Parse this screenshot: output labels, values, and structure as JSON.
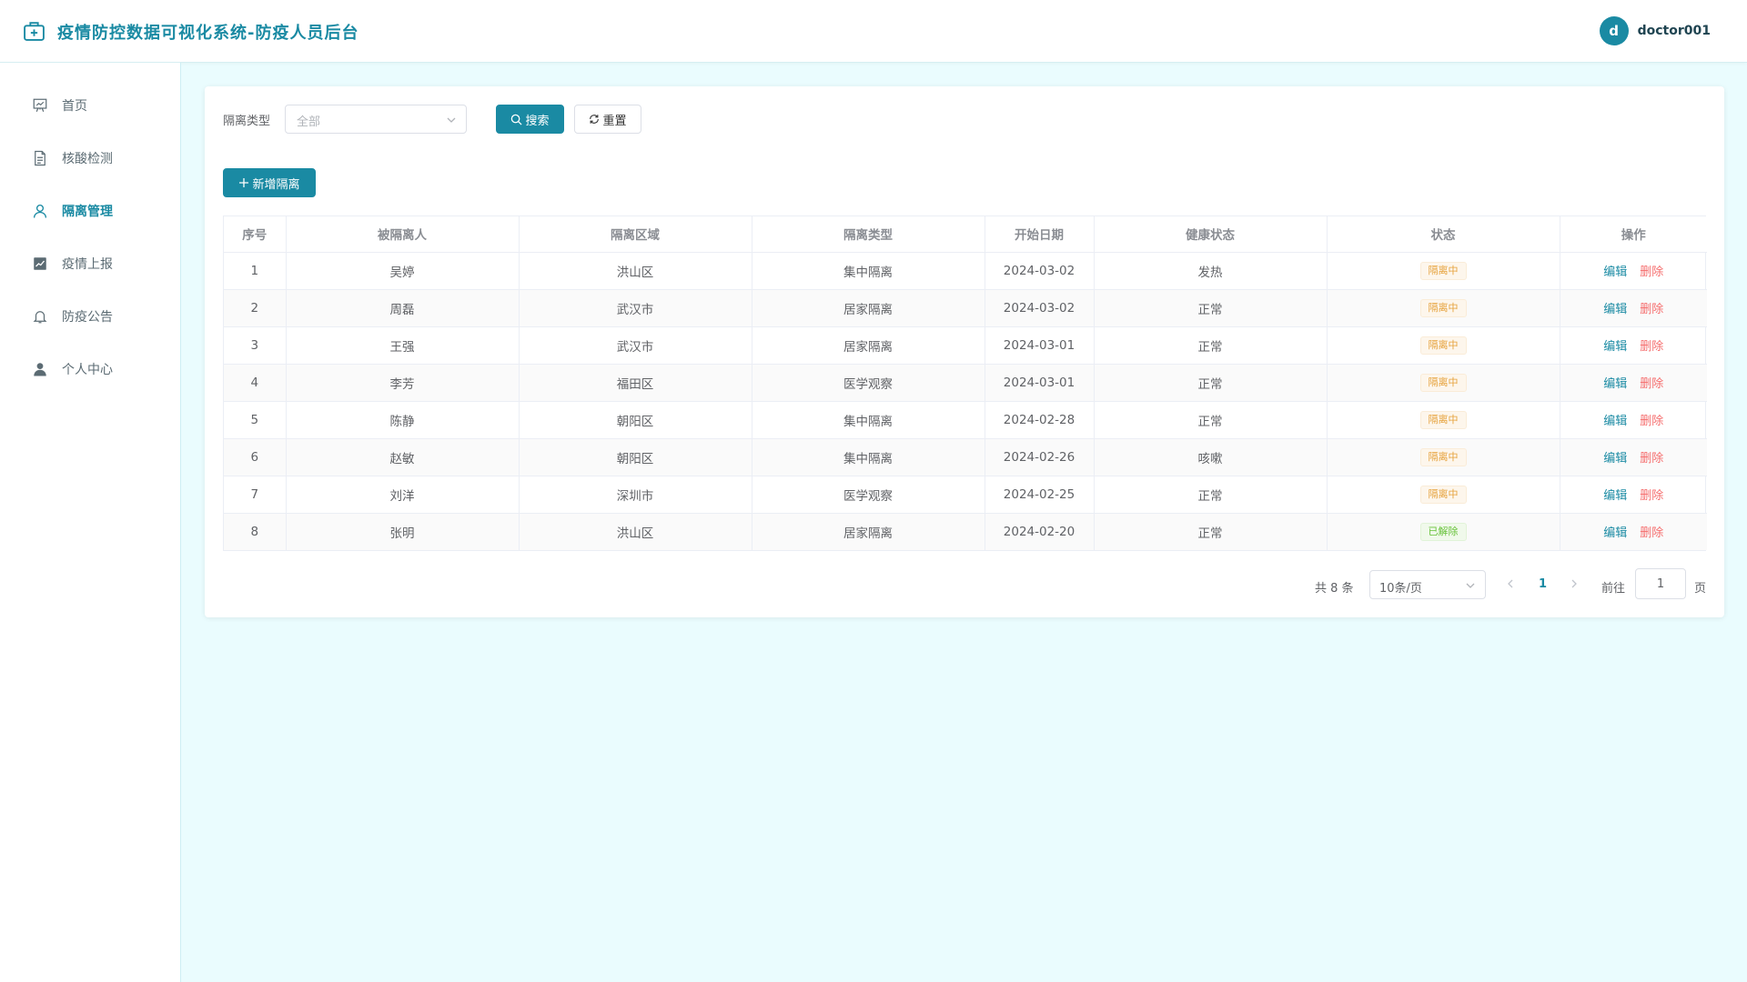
{
  "header": {
    "title": "疫情防控数据可视化系统-防疫人员后台",
    "avatar_letter": "d",
    "username": "doctor001"
  },
  "sidebar": {
    "items": [
      {
        "label": "首页",
        "icon": "presentation-icon",
        "active": false
      },
      {
        "label": "核酸检测",
        "icon": "document-icon",
        "active": false
      },
      {
        "label": "隔离管理",
        "icon": "user-icon",
        "active": true
      },
      {
        "label": "疫情上报",
        "icon": "chart-icon",
        "active": false
      },
      {
        "label": "防疫公告",
        "icon": "bell-icon",
        "active": false
      },
      {
        "label": "个人中心",
        "icon": "person-icon",
        "active": false
      }
    ]
  },
  "filter": {
    "label": "隔离类型",
    "select_value": "全部",
    "search_label": "搜索",
    "reset_label": "重置"
  },
  "toolbar": {
    "add_label": "新增隔离"
  },
  "table": {
    "columns": [
      "序号",
      "被隔离人",
      "隔离区域",
      "隔离类型",
      "开始日期",
      "健康状态",
      "状态",
      "操作"
    ],
    "edit_label": "编辑",
    "delete_label": "删除",
    "rows": [
      [
        "1",
        "吴婷",
        "洪山区",
        "集中隔离",
        "2024-03-02",
        "发热",
        "隔离中"
      ],
      [
        "2",
        "周磊",
        "武汉市",
        "居家隔离",
        "2024-03-02",
        "正常",
        "隔离中"
      ],
      [
        "3",
        "王强",
        "武汉市",
        "居家隔离",
        "2024-03-01",
        "正常",
        "隔离中"
      ],
      [
        "4",
        "李芳",
        "福田区",
        "医学观察",
        "2024-03-01",
        "正常",
        "隔离中"
      ],
      [
        "5",
        "陈静",
        "朝阳区",
        "集中隔离",
        "2024-02-28",
        "正常",
        "隔离中"
      ],
      [
        "6",
        "赵敏",
        "朝阳区",
        "集中隔离",
        "2024-02-26",
        "咳嗽",
        "隔离中"
      ],
      [
        "7",
        "刘洋",
        "深圳市",
        "医学观察",
        "2024-02-25",
        "正常",
        "隔离中"
      ],
      [
        "8",
        "张明",
        "洪山区",
        "居家隔离",
        "2024-02-20",
        "正常",
        "已解除"
      ]
    ]
  },
  "pagination": {
    "total_text": "共 8 条",
    "page_size": "10条/页",
    "current_page": "1",
    "goto_label": "前往",
    "goto_value": "1",
    "page_suffix": "页"
  },
  "colors": {
    "primary": "#1a8aa3",
    "warning": "#e6a23c",
    "success": "#67c23a",
    "danger": "#f56c6c",
    "background": "#eafcfe"
  }
}
